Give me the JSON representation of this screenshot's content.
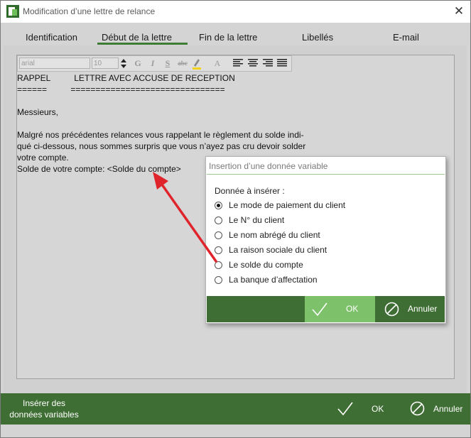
{
  "window": {
    "title": "Modification d’une lettre de relance",
    "close_glyph": "✕"
  },
  "tabs": [
    {
      "label": "Identification"
    },
    {
      "label": "Début de la lettre",
      "active": true
    },
    {
      "label": "Fin de la lettre"
    },
    {
      "label": "Libellés"
    },
    {
      "label": "E-mail"
    }
  ],
  "toolbar": {
    "font": "arial",
    "size": "10",
    "buttons": [
      "G",
      "I",
      "S",
      "abc",
      "A"
    ]
  },
  "document": {
    "lines": [
      "RAPPEL          LETTRE AVEC ACCUSE DE RECEPTION",
      "======          ===============================",
      "",
      "Messieurs,",
      "",
      "Malgré nos précédentes relances vous rappelant le règlement du solde indi-",
      "qué ci-dessous, nous sommes surpris que vous n’ayez pas cru devoir solder",
      "votre compte.",
      "Solde de votre compte: <Solde du compte>"
    ]
  },
  "dialog": {
    "title": "Insertion d’une donnée variable",
    "label": "Donnée à insérer :",
    "options": [
      {
        "label": "Le mode de paiement du client",
        "selected": true
      },
      {
        "label": "Le N° du client",
        "selected": false
      },
      {
        "label": "Le nom abrégé du client",
        "selected": false
      },
      {
        "label": "La raison sociale du client",
        "selected": false
      },
      {
        "label": "Le solde du compte",
        "selected": false
      },
      {
        "label": "La banque d’affectation",
        "selected": false
      }
    ],
    "ok_label": "OK",
    "cancel_label": "Annuler"
  },
  "bottom": {
    "insert_label_line1": "Insérer des",
    "insert_label_line2": "données variables",
    "ok_label": "OK",
    "cancel_label": "Annuler"
  },
  "colors": {
    "accent_green": "#3f6e34",
    "ok_green": "#7dc26b",
    "arrow_red": "#e0242b"
  }
}
